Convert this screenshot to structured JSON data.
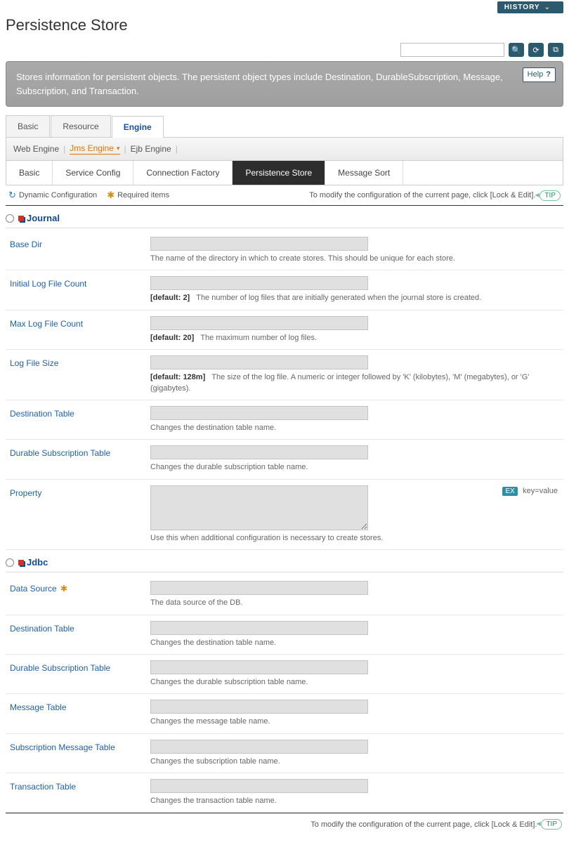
{
  "top": {
    "history_label": "HISTORY"
  },
  "page_title": "Persistence Store",
  "banner": {
    "text": "Stores information for persistent objects. The persistent object types include Destination, DurableSubscription, Message, Subscription, and Transaction.",
    "help_label": "Help"
  },
  "tabs_lvl1": [
    "Basic",
    "Resource",
    "Engine"
  ],
  "tabs_lvl1_active": 2,
  "tabs_lvl2": [
    "Web Engine",
    "Jms Engine",
    "Ejb Engine"
  ],
  "tabs_lvl2_active": 1,
  "tabs_lvl3": [
    "Basic",
    "Service Config",
    "Connection Factory",
    "Persistence Store",
    "Message Sort"
  ],
  "tabs_lvl3_active": 3,
  "legend": {
    "dyn_conf": "Dynamic Configuration",
    "req_items": "Required items",
    "tip_text": "To modify the configuration of the current page, click [Lock & Edit].",
    "tip_label": "TIP"
  },
  "sections": {
    "journal": {
      "title": "Journal",
      "fields": [
        {
          "label": "Base Dir",
          "desc": "The name of the directory in which to create stores. This should be unique for each store."
        },
        {
          "label": "Initial Log File Count",
          "default": "[default: 2]",
          "desc": "The number of log files that are initially generated when the journal store is created."
        },
        {
          "label": "Max Log File Count",
          "default": "[default: 20]",
          "desc": "The maximum number of log files."
        },
        {
          "label": "Log File Size",
          "default": "[default: 128m]",
          "desc": "The size of the log file. A numeric or integer followed by 'K' (kilobytes), 'M' (megabytes), or 'G' (gigabytes)."
        },
        {
          "label": "Destination Table",
          "desc": "Changes the destination table name."
        },
        {
          "label": "Durable Subscription Table",
          "desc": "Changes the durable subscription table name."
        },
        {
          "label": "Property",
          "desc": "Use this when additional configuration is necessary to create stores.",
          "textarea": true,
          "example": "key=value"
        }
      ]
    },
    "jdbc": {
      "title": "Jdbc",
      "fields": [
        {
          "label": "Data Source",
          "required": true,
          "desc": "The data source of the DB."
        },
        {
          "label": "Destination Table",
          "desc": "Changes the destination table name."
        },
        {
          "label": "Durable Subscription Table",
          "desc": "Changes the durable subscription table name."
        },
        {
          "label": "Message Table",
          "desc": "Changes the message table name."
        },
        {
          "label": "Subscription Message Table",
          "desc": "Changes the subscription table name."
        },
        {
          "label": "Transaction Table",
          "desc": "Changes the transaction table name."
        }
      ]
    }
  },
  "bottom": {
    "tip_text": "To modify the configuration of the current page, click [Lock & Edit].",
    "tip_label": "TIP"
  }
}
